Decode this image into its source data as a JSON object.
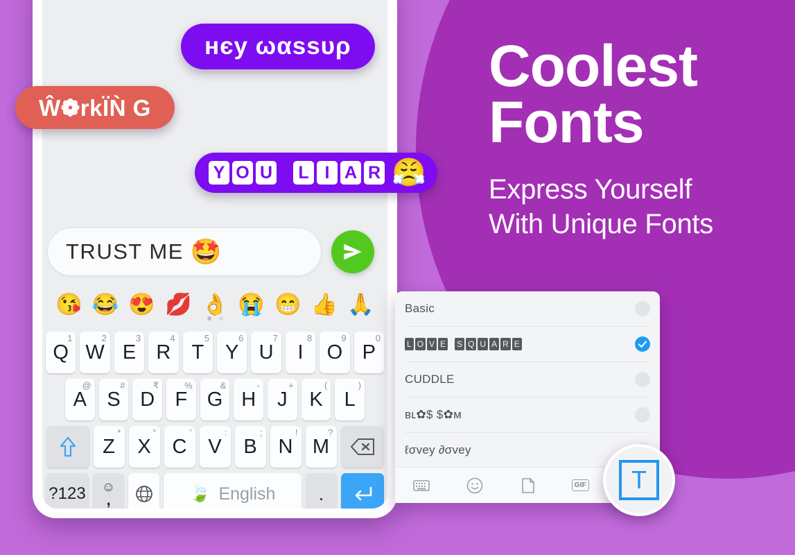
{
  "promo": {
    "title_line1": "Coolest",
    "title_line2": "Fonts",
    "sub_line1": "Express Yourself",
    "sub_line2": "With Unique Fonts"
  },
  "colors": {
    "bg_light_purple": "#c16adb",
    "bg_dark_purple": "#a32fb5",
    "bubble_purple": "#7d0cf0",
    "bubble_red": "#e06055",
    "send_green": "#52c91f",
    "enter_blue": "#3ba5f7",
    "accent_blue": "#1e9bf0",
    "shift_blue": "#3ba5f7"
  },
  "chat": {
    "bubbles": [
      {
        "text": "нєу ωαssυρ",
        "style": "purple"
      },
      {
        "text": "Ŵ❁rkÏǸ G",
        "style": "red"
      }
    ],
    "boxed_bubble": {
      "word1": [
        "Y",
        "O",
        "U"
      ],
      "word2": [
        "L",
        "I",
        "A",
        "R"
      ],
      "emoji": "😤"
    }
  },
  "input": {
    "text": "TRUST ME",
    "emoji": "🤩",
    "send_icon": "send-icon"
  },
  "emoji_strip": {
    "emojis": [
      "😘",
      "😂",
      "😍",
      "💋",
      "👌",
      "😭",
      "😁",
      "👍",
      "🙏"
    ],
    "page_dots": 2,
    "active_dot": 0
  },
  "keyboard": {
    "row1": [
      {
        "key": "Q",
        "hint": "1"
      },
      {
        "key": "W",
        "hint": "2"
      },
      {
        "key": "E",
        "hint": "3"
      },
      {
        "key": "R",
        "hint": "4"
      },
      {
        "key": "T",
        "hint": "5"
      },
      {
        "key": "Y",
        "hint": "6"
      },
      {
        "key": "U",
        "hint": "7"
      },
      {
        "key": "I",
        "hint": "8"
      },
      {
        "key": "O",
        "hint": "9"
      },
      {
        "key": "P",
        "hint": "0"
      }
    ],
    "row2": [
      {
        "key": "A",
        "hint": "@"
      },
      {
        "key": "S",
        "hint": "#"
      },
      {
        "key": "D",
        "hint": "₹"
      },
      {
        "key": "F",
        "hint": "%"
      },
      {
        "key": "G",
        "hint": "&"
      },
      {
        "key": "H",
        "hint": "-"
      },
      {
        "key": "J",
        "hint": "+"
      },
      {
        "key": "K",
        "hint": "("
      },
      {
        "key": "L",
        "hint": ")"
      }
    ],
    "row3": [
      {
        "key": "Z",
        "hint": "*"
      },
      {
        "key": "X",
        "hint": "°"
      },
      {
        "key": "C",
        "hint": "'"
      },
      {
        "key": "V",
        "hint": ":"
      },
      {
        "key": "B",
        "hint": ";"
      },
      {
        "key": "N",
        "hint": "!"
      },
      {
        "key": "M",
        "hint": "?"
      }
    ],
    "shift_label": "shift-icon",
    "backspace_label": "backspace-icon",
    "symbols_label": "?123",
    "comma_top": "☺",
    "comma_bottom": ",",
    "globe_label": "globe-icon",
    "space_label": "English",
    "space_leaf": "🍃",
    "period_label": ".",
    "enter_label": "enter-icon"
  },
  "font_panel": {
    "rows": [
      {
        "label": "Basic",
        "boxed": false,
        "selected": false
      },
      {
        "label": "LOVE SQUARE",
        "boxed": true,
        "selected": true
      },
      {
        "label": "CUDDLE",
        "boxed": false,
        "selected": false
      },
      {
        "label": "ʙʟ✿$ $✿ᴍ",
        "boxed": false,
        "selected": false
      },
      {
        "label": "ℓσvey ∂σvey",
        "boxed": false,
        "selected": false
      }
    ],
    "toolbar": [
      {
        "name": "keyboard-icon",
        "label": ""
      },
      {
        "name": "emoji-icon",
        "label": ""
      },
      {
        "name": "sticker-icon",
        "label": ""
      },
      {
        "name": "gif-icon",
        "label": "GIF"
      }
    ]
  },
  "fab": {
    "label": "T"
  }
}
